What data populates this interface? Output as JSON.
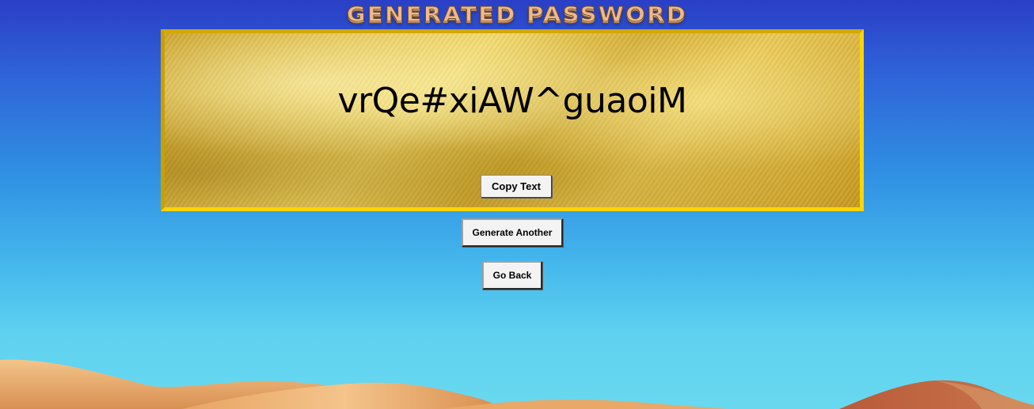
{
  "page": {
    "title": "GENERATED PASSWORD"
  },
  "password_panel": {
    "password": "vrQe#xiAW^guaoiM",
    "copy_label": "Copy Text"
  },
  "actions": {
    "generate_label": "Generate Another",
    "back_label": "Go Back"
  },
  "colors": {
    "panel_border": "#ffd400",
    "sky_top": "#2a3fc6",
    "sky_bottom": "#69d8ef",
    "sand": "#e9a867"
  }
}
